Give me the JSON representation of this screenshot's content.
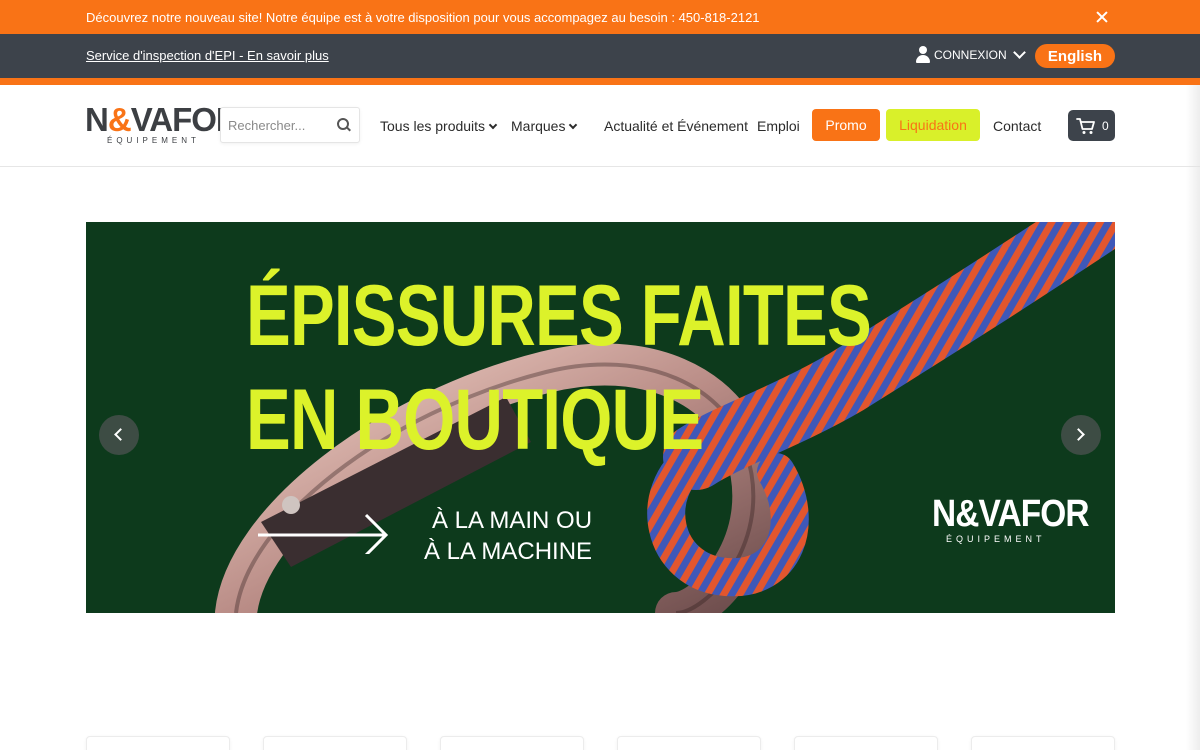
{
  "announcement": {
    "text": "Découvrez notre nouveau site! Notre équipe est à votre disposition pour vous accompagez au besoin : 450-818-2121"
  },
  "service_bar": {
    "link": "Service d'inspection d'EPI - En savoir plus",
    "login_label": "CONNEXION",
    "language_button": "English"
  },
  "logo": {
    "name_part1": "N",
    "name_amp": "&",
    "name_part2": "VAFOR",
    "sub": "ÉQUIPEMENT"
  },
  "search": {
    "placeholder": "Rechercher..."
  },
  "nav": {
    "items": [
      {
        "label": "Tous les produits"
      },
      {
        "label": "Marques"
      },
      {
        "label": "Actualité et Événement"
      },
      {
        "label": "Emploi"
      },
      {
        "label": "Contact"
      }
    ],
    "promo_label": "Promo",
    "liquidation_label": "Liquidation",
    "cart_count": "0"
  },
  "banner": {
    "headline_line1": "ÉPISSURES FAITES",
    "headline_line2": "EN BOUTIQUE",
    "sub_line1": "À LA MAIN OU",
    "sub_line2": "À LA MACHINE",
    "logo_text": "N&VAFOR",
    "logo_sub": "ÉQUIPEMENT"
  },
  "colors": {
    "brand_orange": "#f97316",
    "dark_bar": "#3d434b",
    "lime": "#dcf22a",
    "banner_green": "#0d3a1c"
  }
}
